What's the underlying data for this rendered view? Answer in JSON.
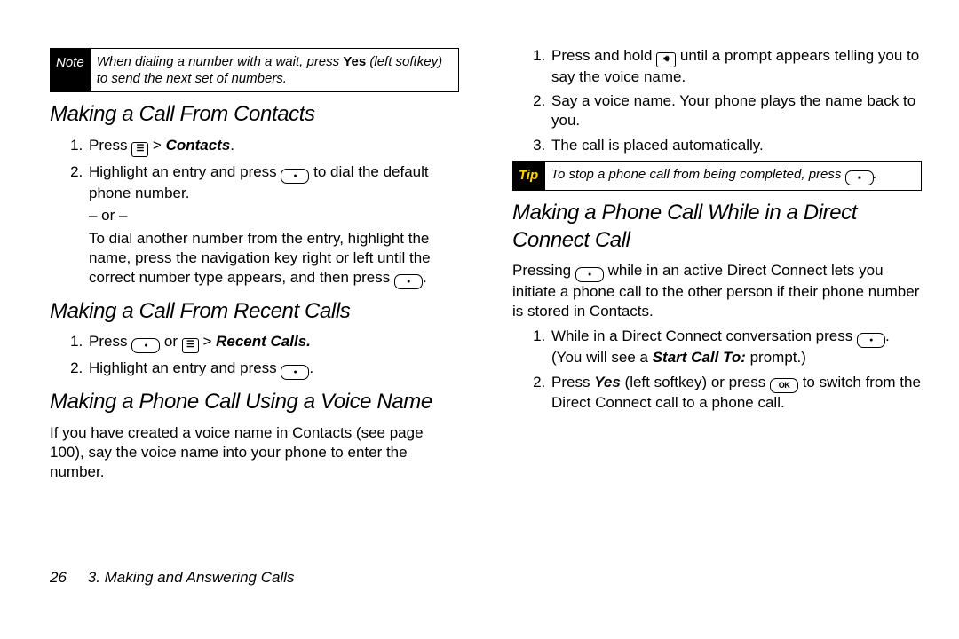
{
  "left": {
    "note": {
      "label": "Note",
      "text_pre": "When dialing a number with a wait, press ",
      "yes": "Yes",
      "text_post": " (left softkey) to send the next set of numbers."
    },
    "h1": "Making a Call From Contacts",
    "s1_1a": "Press ",
    "s1_1b": " > ",
    "s1_1c": "Contacts",
    "s1_1d": ".",
    "s1_2a": "Highlight an entry and press ",
    "s1_2b": " to dial the default phone number.",
    "or": "– or –",
    "s1_2c": "To dial another number from the entry, highlight the name, press the navigation key right or left until the correct number type appears, and then press ",
    "s1_2d": ".",
    "h2": "Making a Call From Recent Calls",
    "s2_1a": "Press ",
    "s2_1b": " or ",
    "s2_1c": " > ",
    "s2_1d": "Recent Calls.",
    "s2_2a": "Highlight an entry and press ",
    "s2_2b": ".",
    "h3": "Making a Phone Call Using a Voice Name",
    "p3": "If you have created a voice name in Contacts (see page 100), say the voice name into your phone to enter the number."
  },
  "right": {
    "s0_1a": "Press and hold ",
    "s0_1b": " until a prompt appears telling you to say the voice name.",
    "s0_2": "Say a voice name. Your phone plays the name back to you.",
    "s0_3": "The call is placed automatically.",
    "tip": {
      "label": "Tip",
      "text_pre": "To stop a phone call from being completed, press ",
      "text_post": "."
    },
    "h1": "Making a Phone Call While in a Direct Connect Call",
    "p1a": "Pressing ",
    "p1b": " while in an active Direct Connect lets you initiate a phone call to the other person if their phone number is stored in Contacts.",
    "s1_1a": "While in a Direct Connect conversation press ",
    "s1_1b": ". (You will see a ",
    "s1_1c": "Start Call To:",
    "s1_1d": " prompt.)",
    "s1_2a": "Press ",
    "s1_2b": "Yes",
    "s1_2c": " (left softkey) or press ",
    "s1_2d": " to switch from the Direct Connect call to a phone call."
  },
  "footer": {
    "page": "26",
    "chapter": "3. Making and Answering Calls"
  }
}
